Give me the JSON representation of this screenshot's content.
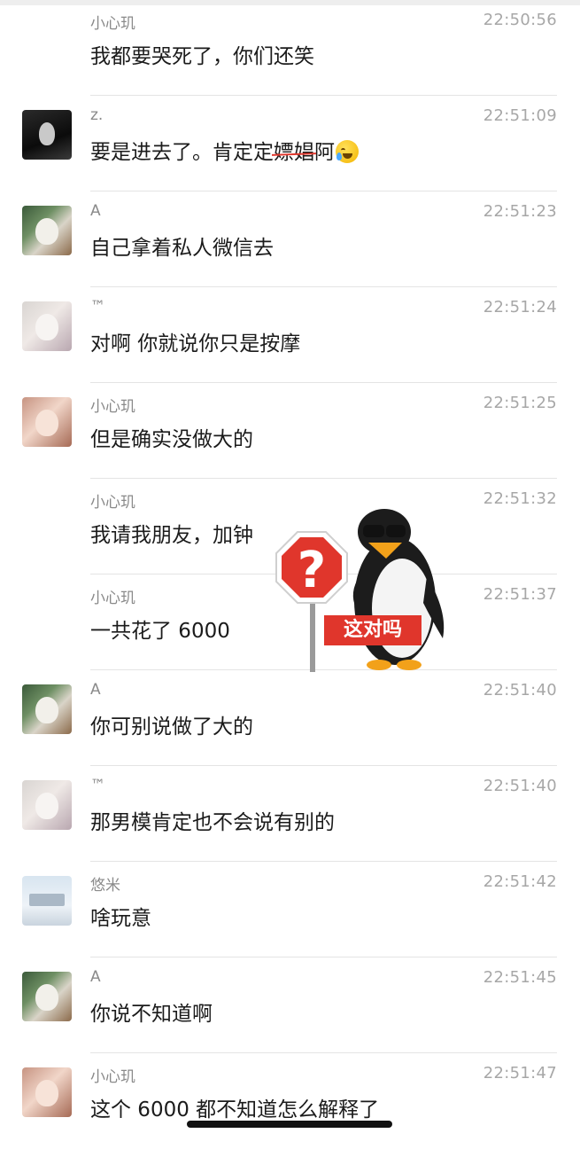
{
  "messages": [
    {
      "sender": "小心玑",
      "time": "22:50:56",
      "text": "我都要哭死了，你们还笑"
    },
    {
      "sender": "z.",
      "time": "22:51:09",
      "text_before": "要是进去了。肯定定",
      "text_struck": "嫖娼",
      "text_after": "阿"
    },
    {
      "sender": "A",
      "time": "22:51:23",
      "text": "自己拿着私人微信去"
    },
    {
      "sender": "™",
      "time": "22:51:24",
      "text": "对啊 你就说你只是按摩"
    },
    {
      "sender": "小心玑",
      "time": "22:51:25",
      "text": "但是确实没做大的"
    },
    {
      "sender": "小心玑",
      "time": "22:51:32",
      "text": "我请我朋友，加钟"
    },
    {
      "sender": "小心玑",
      "time": "22:51:37",
      "text": "一共花了 6000"
    },
    {
      "sender": "A",
      "time": "22:51:40",
      "text": "你可别说做了大的"
    },
    {
      "sender": "™",
      "time": "22:51:40",
      "text": "那男模肯定也不会说有别的"
    },
    {
      "sender": "悠米",
      "time": "22:51:42",
      "text": "啥玩意"
    },
    {
      "sender": "A",
      "time": "22:51:45",
      "text": "你说不知道啊"
    },
    {
      "sender": "小心玑",
      "time": "22:51:47",
      "text": "这个 6000 都不知道怎么解释了"
    }
  ],
  "sticker": {
    "caption": "这对吗",
    "sign_symbol": "?"
  },
  "colors": {
    "sign_red": "#e0362c",
    "penguin_black": "#1c1c1c",
    "penguin_orange": "#f2a11a"
  },
  "icons": {
    "emoji": "crying-laughing-emoji-icon"
  }
}
